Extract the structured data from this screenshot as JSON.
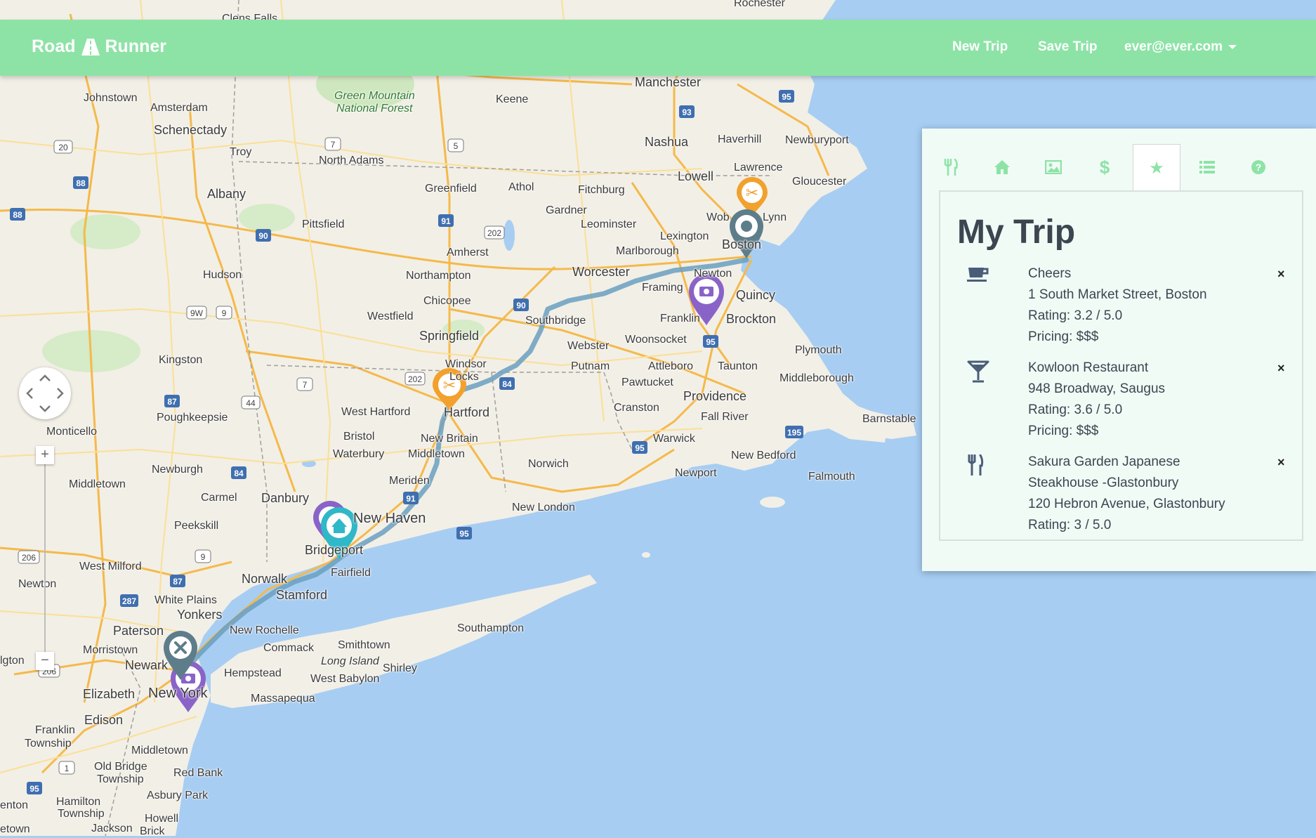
{
  "navbar": {
    "brand_first": "Road",
    "brand_second": "Runner",
    "new_trip": "New Trip",
    "save_trip": "Save Trip",
    "user_email": "ever@ever.com"
  },
  "panel": {
    "tabs": [
      {
        "icon": "fork-knife-icon",
        "active": false
      },
      {
        "icon": "home-icon",
        "active": false
      },
      {
        "icon": "image-icon",
        "active": false
      },
      {
        "icon": "dollar-icon",
        "active": false
      },
      {
        "icon": "star-icon",
        "active": true
      },
      {
        "icon": "list-icon",
        "active": false
      },
      {
        "icon": "question-icon",
        "active": false
      }
    ],
    "title": "My Trip",
    "items": [
      {
        "icon": "coffee-cup-icon",
        "lines": [
          "Cheers",
          "1 South Market Street, Boston",
          "Rating: 3.2 / 5.0",
          "Pricing: $$$"
        ]
      },
      {
        "icon": "cocktail-icon",
        "lines": [
          "Kowloon Restaurant",
          "948 Broadway, Saugus",
          "Rating: 3.6 / 5.0",
          "Pricing: $$$"
        ]
      },
      {
        "icon": "fork-knife-icon",
        "lines": [
          "Sakura Garden Japanese",
          "Steakhouse -Glastonbury",
          "120 Hebron Avenue, Glastonbury",
          "Rating: 3 / 5.0"
        ]
      }
    ],
    "close_glyph": "×"
  },
  "map": {
    "zoom_in": "+",
    "zoom_out": "−",
    "labels": {
      "clens_falls": "Clens Falls",
      "rochester": "Rochester",
      "manchester": "Manchester",
      "green_mountain": "Green Mountain",
      "national_forest": "National Forest",
      "keene": "Keene",
      "johnstown": "Johnstown",
      "amsterdam": "Amsterdam",
      "schenectady": "Schenectady",
      "troy": "Troy",
      "albany": "Albany",
      "north_adams": "North Adams",
      "nashua": "Nashua",
      "haverhill": "Haverhill",
      "newburyport": "Newburyport",
      "lowell": "Lowell",
      "lawrence": "Lawrence",
      "gloucester": "Gloucester",
      "greenfield": "Greenfield",
      "athol": "Athol",
      "fitchburg": "Fitchburg",
      "gardner": "Gardner",
      "leominster": "Leominster",
      "woburn": "Wob",
      "lynn": "Lynn",
      "pittsfield": "Pittsfield",
      "lexington": "Lexington",
      "boston": "Boston",
      "amherst": "Amherst",
      "marlborough": "Marlborough",
      "northampton": "Northampton",
      "worcester": "Worcester",
      "newton": "Newton",
      "hudson": "Hudson",
      "chicopee": "Chicopee",
      "framingham": "Framing",
      "quincy": "Quincy",
      "westfield": "Westfield",
      "southbridge": "Southbridge",
      "franklin": "Franklin",
      "brockton": "Brockton",
      "springfield": "Springfield",
      "webster": "Webster",
      "woonsocket": "Woonsocket",
      "plymouth": "Plymouth",
      "kingston": "Kingston",
      "windsor": "Windsor",
      "locks": "Locks",
      "putnam": "Putnam",
      "attleboro": "Attleboro",
      "taunton": "Taunton",
      "middleborough": "Middleborough",
      "pawtucket": "Pawtucket",
      "providence": "Providence",
      "poughkeepsie": "Poughkeepsie",
      "west_hartford": "West Hartford",
      "hartford": "Hartford",
      "cranston": "Cranston",
      "fall_river": "Fall River",
      "barnstable": "Barnstable",
      "monticello": "Monticello",
      "bristol": "Bristol",
      "new_britain": "New Britain",
      "warwick": "Warwick",
      "waterbury": "Waterbury",
      "middletown_ct": "Middletown",
      "new_bedford": "New Bedford",
      "newburgh": "Newburgh",
      "norwich": "Norwich",
      "middletown_ny": "Middletown",
      "meriden": "Meriden",
      "newport": "Newport",
      "falmouth": "Falmouth",
      "carmel": "Carmel",
      "danbury": "Danbury",
      "new_london": "New London",
      "peekskill": "Peekskill",
      "new_haven": "New Haven",
      "bridgeport": "Bridgeport",
      "west_milford": "West Milford",
      "fairfield": "Fairfield",
      "newton_nj": "Newton",
      "norwalk": "Norwalk",
      "stamford": "Stamford",
      "white_plains": "White Plains",
      "yonkers": "Yonkers",
      "southampton": "Southampton",
      "paterson": "Paterson",
      "new_rochelle": "New Rochelle",
      "morristown": "Morristown",
      "commack": "Commack",
      "smithtown": "Smithtown",
      "newark": "Newark",
      "long_island": "Long Island",
      "shirley": "Shirley",
      "hempstead": "Hempstead",
      "west_babylon": "West Babylon",
      "elizabeth": "Elizabeth",
      "new_york": "New York",
      "massapequa": "Massapequa",
      "edison": "Edison",
      "franklin_township": "Franklin",
      "township": "Township",
      "middletown_nj": "Middletown",
      "old_bridge": "Old Bridge",
      "old_bridge_township": "Township",
      "red_bank": "Red Bank",
      "asbury_park": "Asbury Park",
      "hamilton": "Hamilton",
      "hamilton_township": "Township",
      "howell": "Howell",
      "jackson": "Jackson",
      "brick": "Brick",
      "lington": "lgton",
      "enton": "enton",
      "etown": "etown"
    }
  },
  "colors": {
    "navbar": "#8de3a6",
    "water": "#a7cdf2",
    "land": "#f2efe6",
    "route": "#6a9fbf",
    "restaurant_pin": "#f1a12c",
    "photo_pin": "#8a63c8",
    "home_pin": "#2fb8c8",
    "start_pin": "#5d7d8a"
  }
}
